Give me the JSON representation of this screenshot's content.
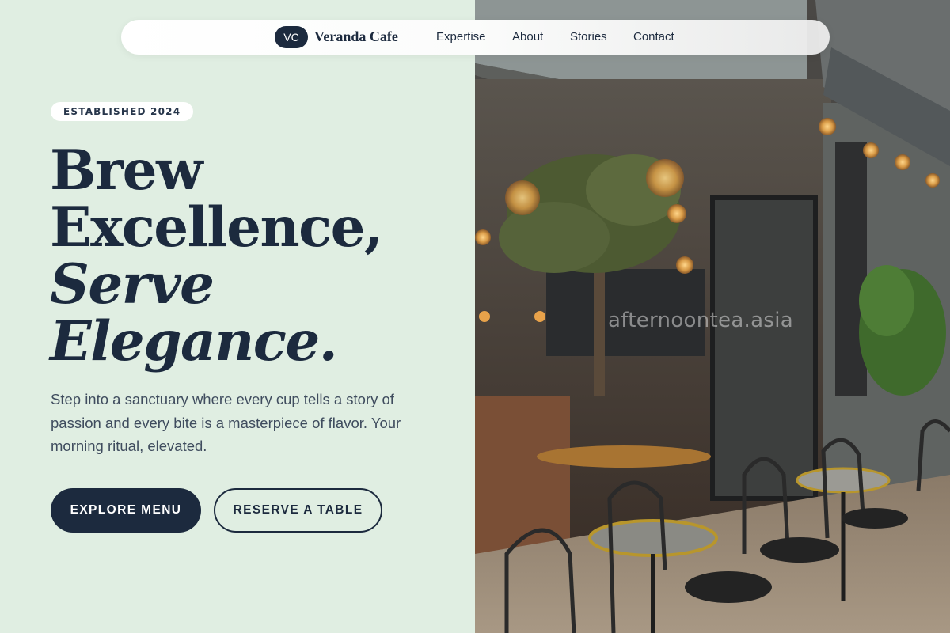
{
  "nav": {
    "logo_initials": "VC",
    "brand": "Veranda Cafe",
    "links": [
      "Expertise",
      "About",
      "Stories",
      "Contact"
    ]
  },
  "hero": {
    "badge": "ESTABLISHED 2024",
    "headline": {
      "line1": "Brew",
      "line2": "Excellence,",
      "line3": "Serve",
      "line4": "Elegance."
    },
    "description": "Step into a sanctuary where every cup tells a story of passion and every bite is a masterpiece of flavor. Your morning ritual, elevated.",
    "primary_cta": "EXPLORE MENU",
    "secondary_cta": "RESERVE A TABLE"
  },
  "photo": {
    "watermark": "afternoontea.asia"
  },
  "colors": {
    "background": "#e0eee2",
    "navy": "#1c2a3e",
    "text_muted": "#3f4c5e"
  }
}
